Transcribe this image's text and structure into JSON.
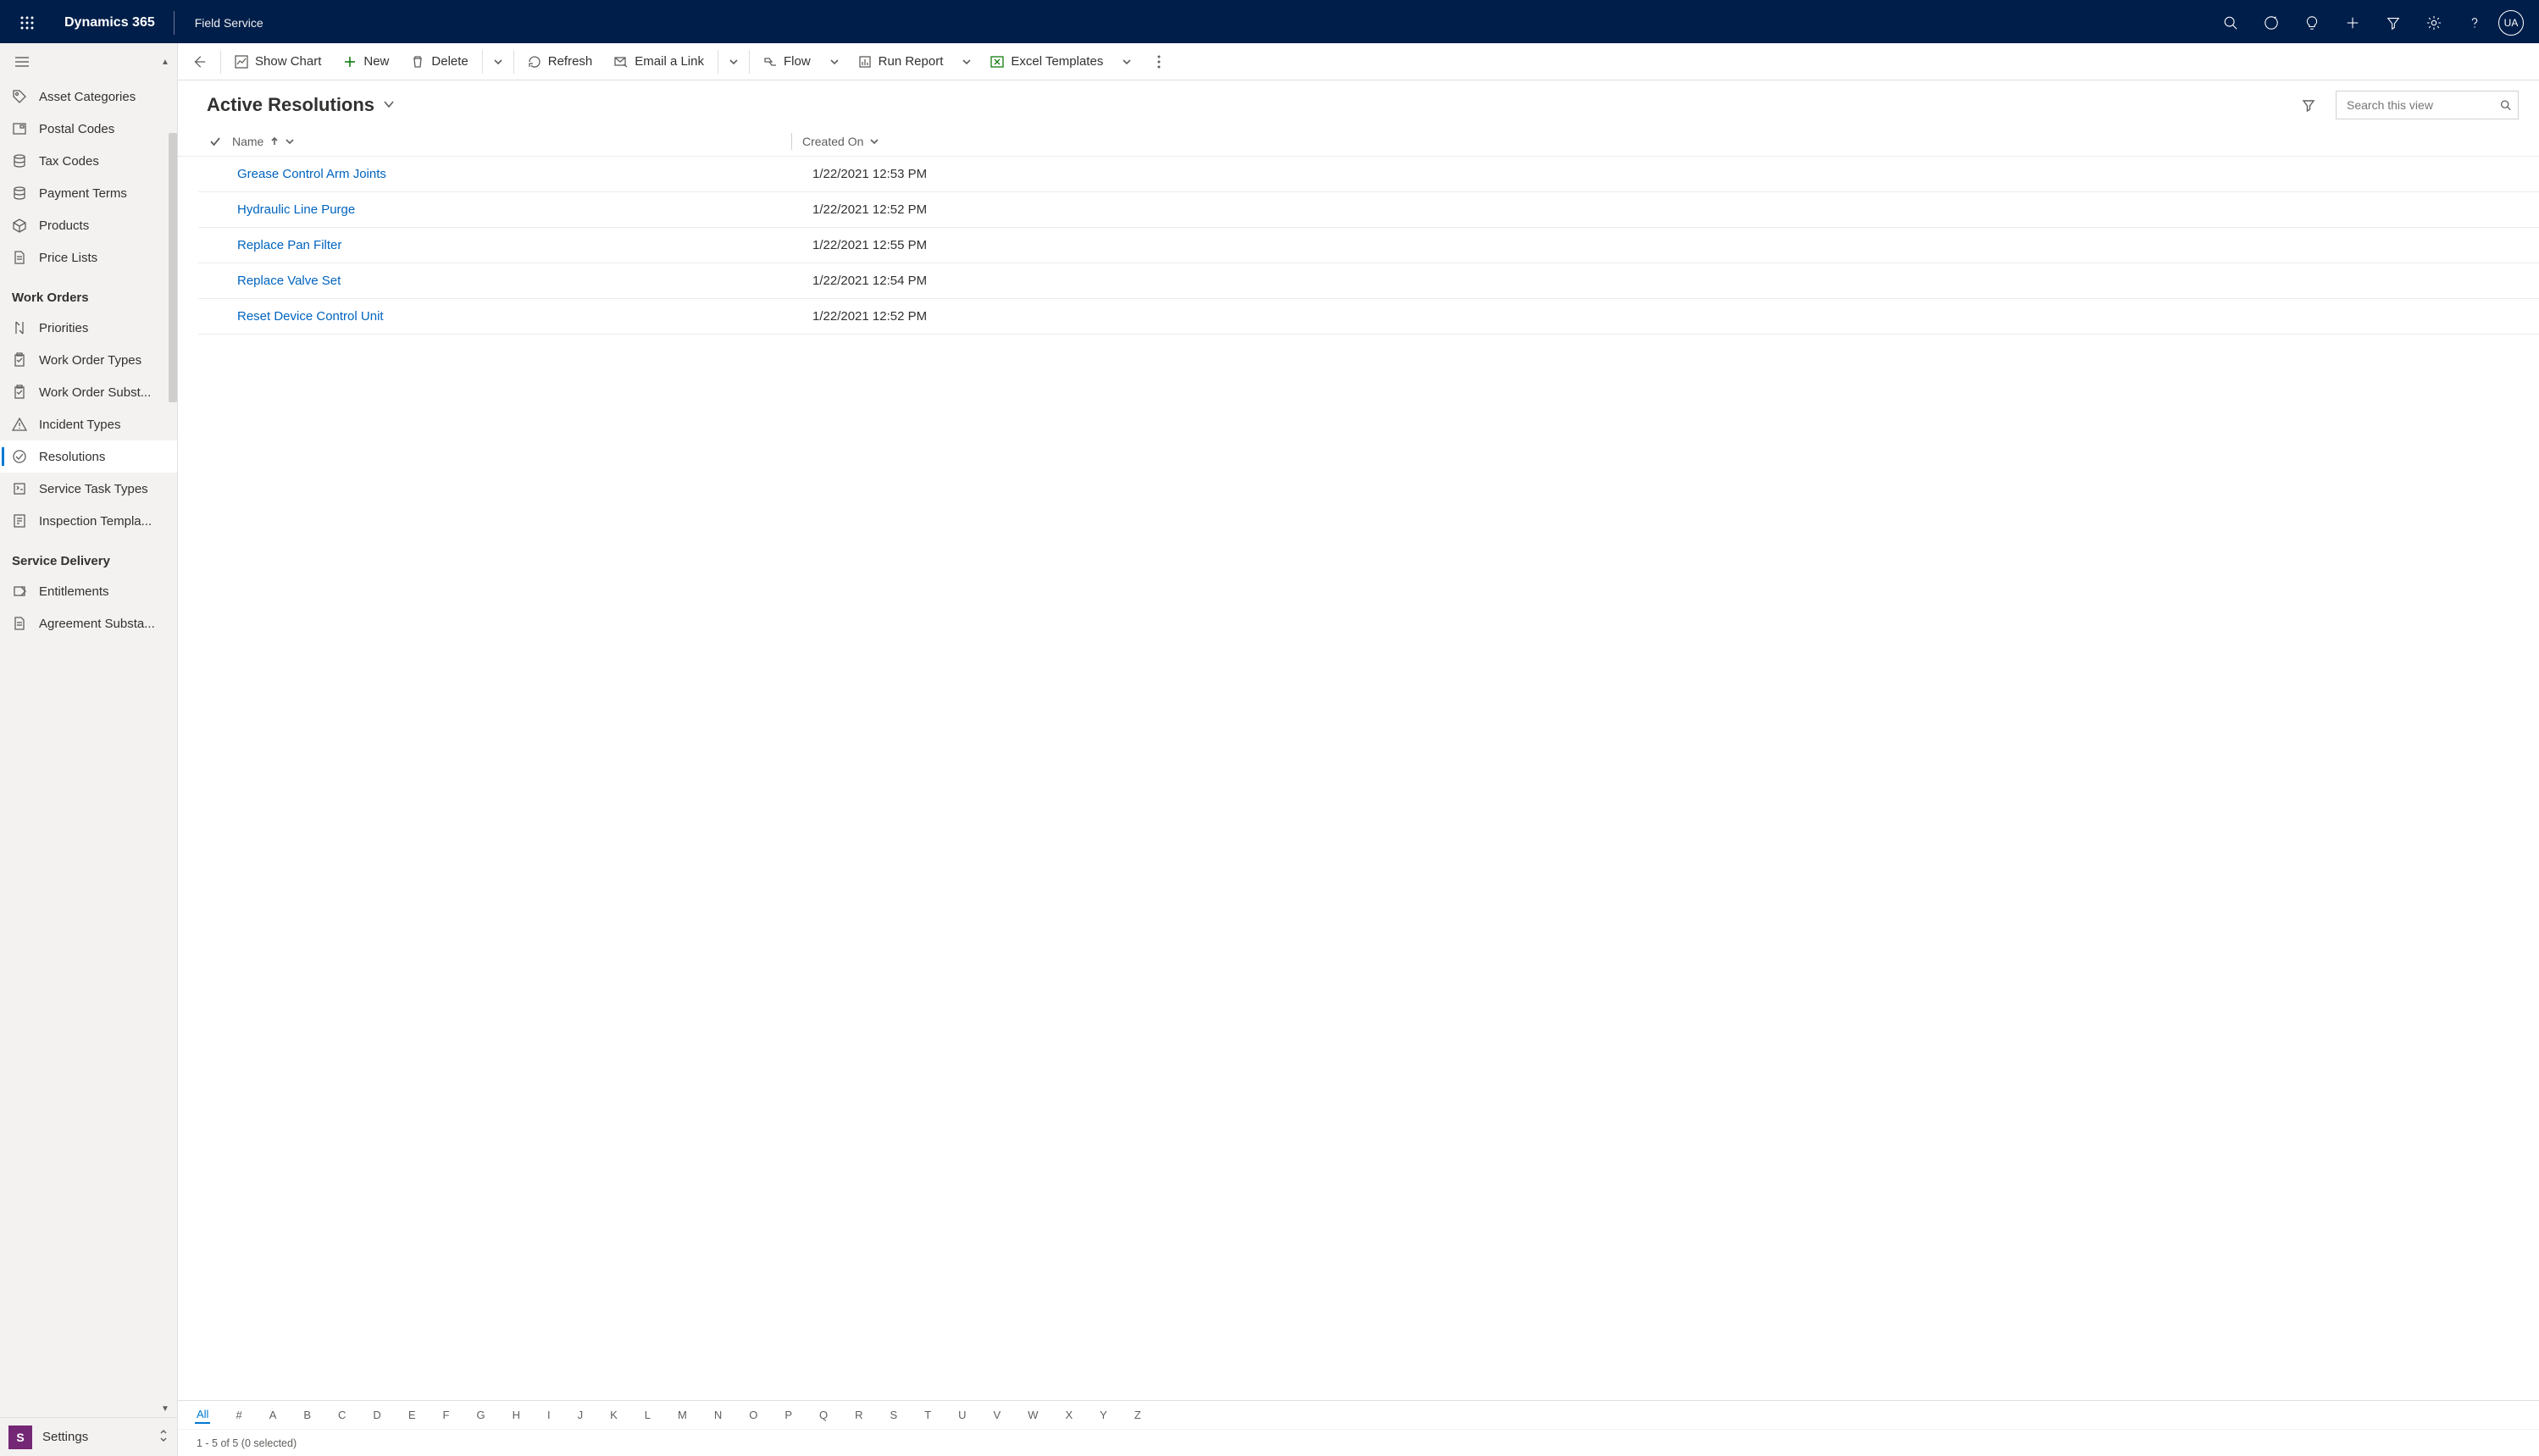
{
  "header": {
    "brand": "Dynamics 365",
    "app_name": "Field Service",
    "avatar_initials": "UA"
  },
  "sidebar": {
    "top_items": [
      {
        "icon": "tag",
        "label": "Asset Categories"
      },
      {
        "icon": "postal",
        "label": "Postal Codes"
      },
      {
        "icon": "stack",
        "label": "Tax Codes"
      },
      {
        "icon": "stack",
        "label": "Payment Terms"
      },
      {
        "icon": "box",
        "label": "Products"
      },
      {
        "icon": "doc",
        "label": "Price Lists"
      }
    ],
    "group1_title": "Work Orders",
    "group1_items": [
      {
        "icon": "priority",
        "label": "Priorities"
      },
      {
        "icon": "clipboard",
        "label": "Work Order Types"
      },
      {
        "icon": "clipboard",
        "label": "Work Order Subst..."
      },
      {
        "icon": "warning",
        "label": "Incident Types"
      },
      {
        "icon": "check-circle",
        "label": "Resolutions",
        "active": true
      },
      {
        "icon": "service",
        "label": "Service Task Types"
      },
      {
        "icon": "inspect",
        "label": "Inspection Templa..."
      }
    ],
    "group2_title": "Service Delivery",
    "group2_items": [
      {
        "icon": "entitle",
        "label": "Entitlements"
      },
      {
        "icon": "doc",
        "label": "Agreement Substa..."
      }
    ],
    "area_badge": "S",
    "area_label": "Settings"
  },
  "commands": {
    "show_chart": "Show Chart",
    "new": "New",
    "delete": "Delete",
    "refresh": "Refresh",
    "email_link": "Email a Link",
    "flow": "Flow",
    "run_report": "Run Report",
    "excel_templates": "Excel Templates"
  },
  "view": {
    "title": "Active Resolutions",
    "search_placeholder": "Search this view"
  },
  "columns": {
    "name": "Name",
    "created_on": "Created On"
  },
  "rows": [
    {
      "name": "Grease Control Arm Joints",
      "created_on": "1/22/2021 12:53 PM"
    },
    {
      "name": "Hydraulic Line Purge",
      "created_on": "1/22/2021 12:52 PM"
    },
    {
      "name": "Replace Pan Filter",
      "created_on": "1/22/2021 12:55 PM"
    },
    {
      "name": "Replace Valve Set",
      "created_on": "1/22/2021 12:54 PM"
    },
    {
      "name": "Reset Device Control Unit",
      "created_on": "1/22/2021 12:52 PM"
    }
  ],
  "alphabar": [
    "All",
    "#",
    "A",
    "B",
    "C",
    "D",
    "E",
    "F",
    "G",
    "H",
    "I",
    "J",
    "K",
    "L",
    "M",
    "N",
    "O",
    "P",
    "Q",
    "R",
    "S",
    "T",
    "U",
    "V",
    "W",
    "X",
    "Y",
    "Z"
  ],
  "status": "1 - 5 of 5 (0 selected)"
}
